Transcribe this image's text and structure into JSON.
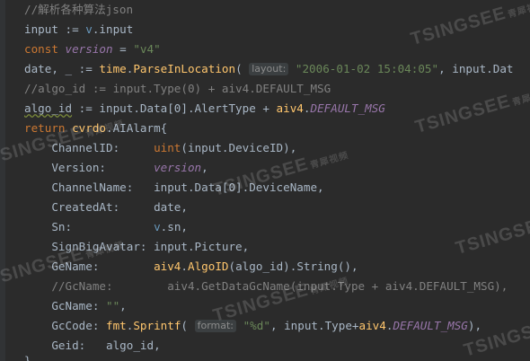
{
  "code": {
    "l1": "//解析各种算法json",
    "l2_a": "input := ",
    "l2_b": "v",
    "l2_c": ".input",
    "l3_kw": "const ",
    "l3_var": "version",
    "l3_eq": " = ",
    "l3_str": "\"v4\"",
    "l4_a": "date, _ := ",
    "l4_pkg": "time",
    "l4_dot": ".",
    "l4_fn": "ParseInLocation",
    "l4_paren": "( ",
    "l4_hint": "layout:",
    "l4_str": " \"2006-01-02 15:04:05\"",
    "l4_rest": ", input.Dat",
    "l5": "//algo_id := input.Type(0) + aiv4.DEFAULT_MSG",
    "l6_var": "algo_id",
    "l6_mid": " := input.Data[0].AlertType + ",
    "l6_pkg": "aiv4",
    "l6_dot": ".",
    "l6_const": "DEFAULT_MSG",
    "l7_kw": "return ",
    "l7_pkg": "cvrdo",
    "l7_rest": ".AIAlarm{",
    "f1_k": "    ChannelID:     ",
    "f1_fn": "uint",
    "f1_rest": "(input.DeviceID),",
    "f2_k": "    Version:       ",
    "f2_v": "version",
    "f2_c": ",",
    "f3_k": "    ChannelName:   ",
    "f3_v": "input.Data[0].DeviceName,",
    "f4_k": "    CreatedAt:     ",
    "f4_v": "date,",
    "f5_k": "    Sn:            ",
    "f5_v1": "v",
    "f5_v2": ".sn,",
    "f6_k": "    SignBigAvatar: ",
    "f6_v": "input.Picture,",
    "f7_k": "    GeName:        ",
    "f7_pkg": "aiv4",
    "f7_dot": ".",
    "f7_fn": "AlgoID",
    "f7_rest": "(algo_id).String(),",
    "f8": "    //GcName:        aiv4.GetDataGcName(input.Type + aiv4.DEFAULT_MSG),",
    "f9_k": "    GcName: ",
    "f9_v": "\"\"",
    "f9_c": ",",
    "f10_k": "    GcCode: ",
    "f10_pkg": "fmt",
    "f10_dot": ".",
    "f10_fn": "Sprintf",
    "f10_paren": "( ",
    "f10_hint": "format:",
    "f10_str": " \"%d\"",
    "f10_mid": ", input.Type+",
    "f10_pkg2": "aiv4",
    "f10_dot2": ".",
    "f10_const": "DEFAULT_MSG",
    "f10_end": "),",
    "f11_k": "    Geid:   ",
    "f11_v": "algo_id,",
    "end": "}"
  },
  "watermark": {
    "brand": "TSINGSEE",
    "cn": "青犀视频"
  }
}
